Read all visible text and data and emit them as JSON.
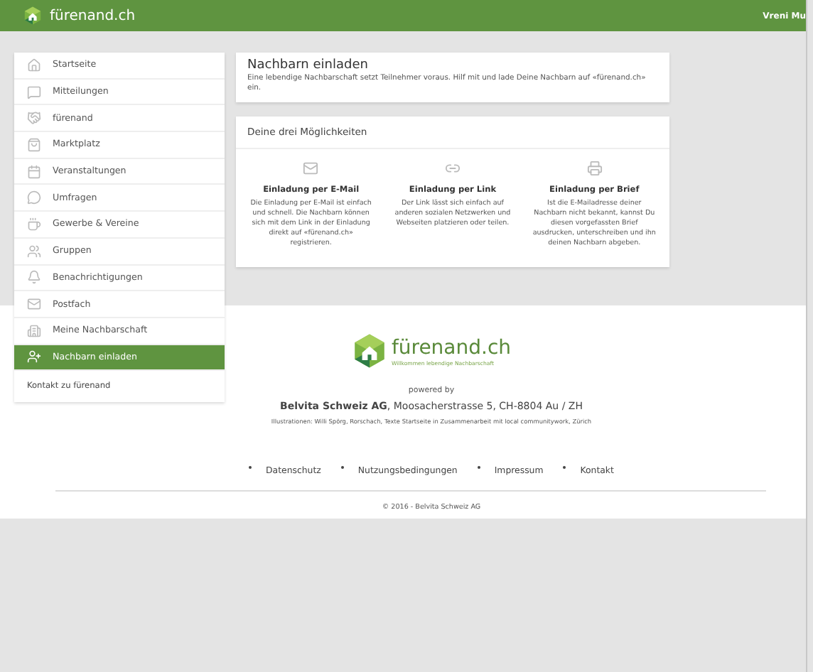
{
  "header": {
    "logo_text": "fürenand.ch",
    "user": "Vreni Mu"
  },
  "sidebar": {
    "items": [
      {
        "label": "Startseite",
        "selected": false
      },
      {
        "label": "Mitteilungen",
        "selected": false
      },
      {
        "label": "fürenand",
        "selected": false
      },
      {
        "label": "Marktplatz",
        "selected": false
      },
      {
        "label": "Veranstaltungen",
        "selected": false
      },
      {
        "label": "Umfragen",
        "selected": false
      },
      {
        "label": "Gewerbe & Vereine",
        "selected": false
      },
      {
        "label": "Gruppen",
        "selected": false
      },
      {
        "label": "Benachrichtigungen",
        "selected": false
      },
      {
        "label": "Postfach",
        "selected": false
      },
      {
        "label": "Meine Nachbarschaft",
        "selected": false
      },
      {
        "label": "Nachbarn einladen",
        "selected": true
      }
    ],
    "contact": "Kontakt zu fürenand"
  },
  "intro": {
    "title": "Nachbarn einladen",
    "text": "Eine lebendige Nachbarschaft setzt Teilnehmer voraus. Hilf mit und lade Deine Nachbarn auf «fürenand.ch» ein."
  },
  "options": {
    "heading": "Deine drei Möglichkeiten",
    "items": [
      {
        "kind": "email",
        "title": "Einladung per E-Mail",
        "text": "Die Einladung per E-Mail ist einfach und schnell. Die Nachbarn können sich mit dem Link in der Einladung direkt auf «fürenand.ch» registrieren."
      },
      {
        "kind": "link",
        "title": "Einladung per Link",
        "text": "Der Link lässt sich einfach auf anderen sozialen Netzwerken und Webseiten platzieren oder teilen."
      },
      {
        "kind": "letter",
        "title": "Einladung per Brief",
        "text": "Ist die E-Mailadresse deiner Nachbarn nicht bekannt, kannst Du diesen vorgefassten Brief ausdrucken, unterschreiben und ihn deinen Nachbarn abgeben."
      }
    ]
  },
  "footer": {
    "logo_text": "fürenand.ch",
    "tagline": "Willkommen lebendige Nachbarschaft",
    "powered_by": "powered by",
    "company": "**Belvita Schweiz AG**, Moosacherstrasse 5, CH-8804 Au / ZH",
    "credits": "Illustrationen: Willi Spörg, Rorschach, Texte Startseite in Zusammenarbeit mit local communitywork, Zürich",
    "links": [
      "Datenschutz",
      "Nutzungsbedingungen",
      "Impressum",
      "Kontakt"
    ],
    "copyright": "© 2016 - Belvita Schweiz AG"
  }
}
